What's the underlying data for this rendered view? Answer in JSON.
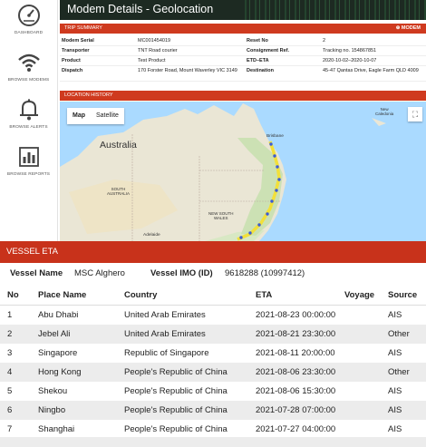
{
  "sidebar": {
    "items": [
      {
        "label": "DASHBOARD",
        "icon": "dashboard-gauge-icon"
      },
      {
        "label": "BROWSE MODEMS",
        "icon": "wifi-icon"
      },
      {
        "label": "BROWSE ALERTS",
        "icon": "bell-icon"
      },
      {
        "label": "BROWSE REPORTS",
        "icon": "bar-chart-icon"
      }
    ]
  },
  "header": {
    "title": "Modem Details - Geolocation"
  },
  "trip_summary": {
    "title": "TRIP SUMMARY",
    "right_label": "⊕ MODEM",
    "rows": [
      {
        "l1": "Modem Serial",
        "v1": "MC001454019",
        "l2": "Reset No",
        "v2": "2"
      },
      {
        "l1": "Transporter",
        "v1": "TNT Road courier",
        "l2": "Consignment Ref.",
        "v2": "Tracking no. 154867851"
      },
      {
        "l1": "Product",
        "v1": "Test Product",
        "l2": "ETD–ETA",
        "v2": "2020-10-02–2020-10-07"
      },
      {
        "l1": "Dispatch",
        "v1": "170 Forster Road, Mount Waverley VIC 3149",
        "l2": "Destination",
        "v2": "45-47 Qantas Drive, Eagle Farm QLD 4009"
      }
    ]
  },
  "location_history": {
    "title": "LOCATION HISTORY",
    "map_button": "Map",
    "satellite_button": "Satellite",
    "labels": {
      "australia": "Australia",
      "south_australia": "SOUTH\nAUSTRALIA",
      "new_south_wales": "NEW SOUTH\nWALES",
      "brisbane": "Brisbane",
      "adelaide": "Adelaide",
      "new_caledonia": "New\nCaledonia"
    }
  },
  "vessel_eta": {
    "title": "VESSEL ETA",
    "vessel_name_label": "Vessel Name",
    "vessel_name": "MSC Alghero",
    "vessel_imo_label": "Vessel IMO (ID)",
    "vessel_imo": "9618288 (10997412)",
    "columns": [
      "No",
      "Place Name",
      "Country",
      "ETA",
      "Voyage",
      "Source"
    ],
    "rows": [
      {
        "no": "1",
        "place": "Abu Dhabi",
        "country": "United Arab Emirates",
        "eta": "2021-08-23 00:00:00",
        "voyage": "",
        "source": "AIS"
      },
      {
        "no": "2",
        "place": "Jebel Ali",
        "country": "United Arab Emirates",
        "eta": "2021-08-21 23:30:00",
        "voyage": "",
        "source": "Other"
      },
      {
        "no": "3",
        "place": "Singapore",
        "country": "Republic of Singapore",
        "eta": "2021-08-11 20:00:00",
        "voyage": "",
        "source": "AIS"
      },
      {
        "no": "4",
        "place": "Hong Kong",
        "country": "People's Republic of China",
        "eta": "2021-08-06 23:30:00",
        "voyage": "",
        "source": "Other"
      },
      {
        "no": "5",
        "place": "Shekou",
        "country": "People's Republic of China",
        "eta": "2021-08-06 15:30:00",
        "voyage": "",
        "source": "AIS"
      },
      {
        "no": "6",
        "place": "Ningbo",
        "country": "People's Republic of China",
        "eta": "2021-07-28 07:00:00",
        "voyage": "",
        "source": "AIS"
      },
      {
        "no": "7",
        "place": "Shanghai",
        "country": "People's Republic of China",
        "eta": "2021-07-27 04:00:00",
        "voyage": "",
        "source": "AIS"
      }
    ]
  },
  "colors": {
    "accent_red": "#c8321b",
    "header_dark": "#1d2a22",
    "route_yellow": "#f2e03a",
    "route_blue": "#3b5bd6"
  }
}
